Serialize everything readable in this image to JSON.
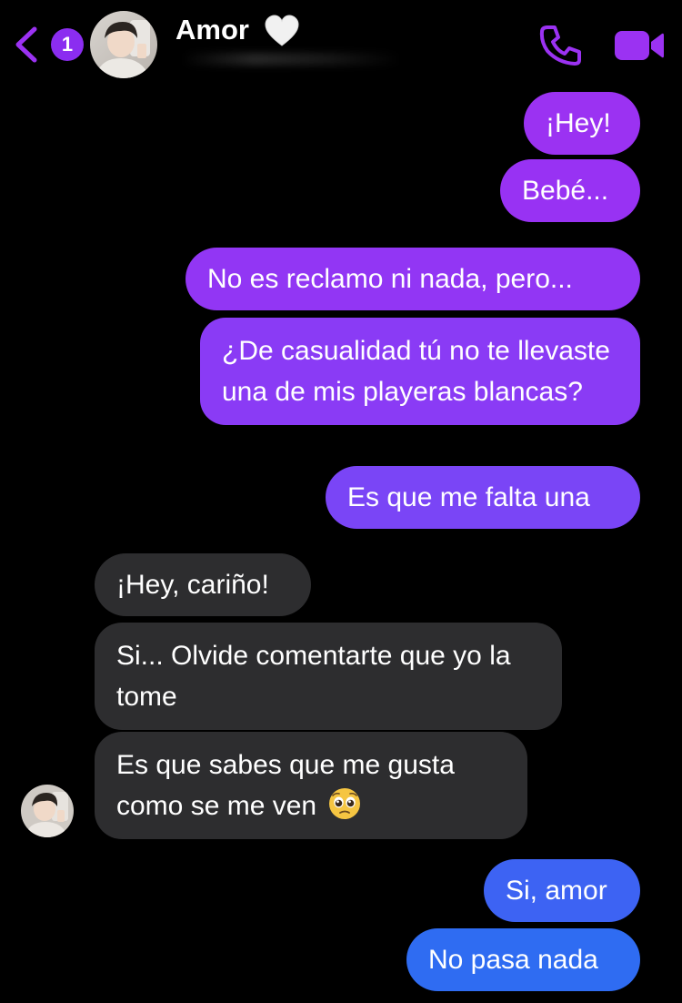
{
  "header": {
    "back_badge": "1",
    "contact_name": "Amor",
    "contact_emoji": "white-heart",
    "call_icon": "phone-icon",
    "video_icon": "video-camera-icon"
  },
  "colors": {
    "accent": "#9b32f2",
    "bubble_purple": "#8f37f5",
    "bubble_blue": "#2e6cf2",
    "incoming_bubble": "#2d2d2f",
    "background": "#000000"
  },
  "messages": [
    {
      "direction": "outgoing",
      "text": "¡Hey!"
    },
    {
      "direction": "outgoing",
      "text": "Bebé..."
    },
    {
      "direction": "outgoing",
      "text": "No es reclamo ni nada, pero..."
    },
    {
      "direction": "outgoing",
      "text": "¿De casualidad tú no te llevaste una de mis playeras blancas?"
    },
    {
      "direction": "outgoing",
      "text": "Es que me falta una"
    },
    {
      "direction": "incoming",
      "text": "¡Hey, cariño!"
    },
    {
      "direction": "incoming",
      "text": "Si... Olvide comentarte que yo la tome"
    },
    {
      "direction": "incoming",
      "text": "Es que sabes que me gusta como se me ven",
      "emoji": "pleading-face"
    },
    {
      "direction": "outgoing",
      "text": "Si, amor"
    },
    {
      "direction": "outgoing",
      "text": "No pasa nada"
    }
  ]
}
